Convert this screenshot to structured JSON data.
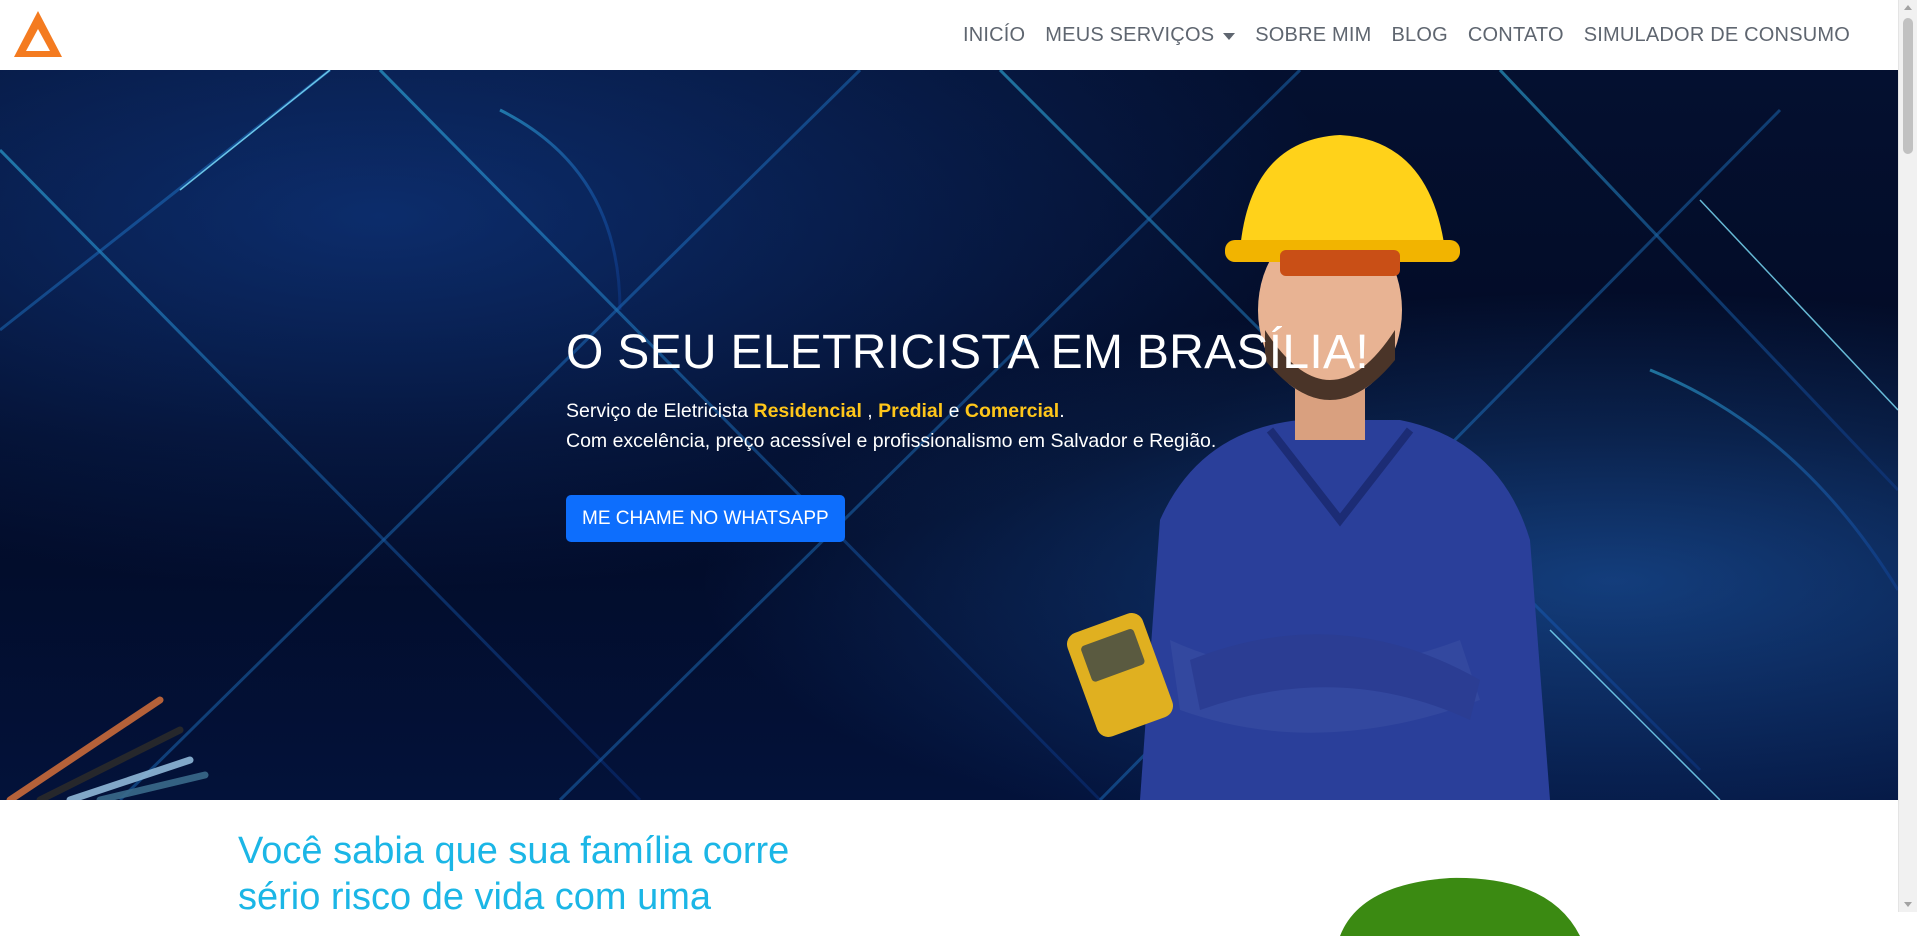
{
  "nav": {
    "logo_icon": "triangle-logo-icon",
    "items": [
      {
        "label": "INICÍO"
      },
      {
        "label": "MEUS SERVIÇOS",
        "dropdown": true
      },
      {
        "label": "SOBRE MIM"
      },
      {
        "label": "BLOG"
      },
      {
        "label": "CONTATO"
      },
      {
        "label": "SIMULADOR DE CONSUMO"
      }
    ]
  },
  "hero": {
    "title": "O SEU ELETRICISTA EM BRASÍLIA!",
    "line1_prefix": "Serviço de Eletricista ",
    "residencial": "Residencial",
    "sep1": " , ",
    "predial": "Predial",
    "sep2": " e ",
    "comercial": "Comercial",
    "line1_suffix": ".",
    "line2": "Com excelência, preço acessível e profissionalismo em Salvador e Região.",
    "cta_label": "ME CHAME NO WHATSAPP"
  },
  "info": {
    "heading": "Você sabia que sua família corre sério risco de vida com uma"
  },
  "colors": {
    "accent_orange": "#f47b20",
    "highlight_yellow": "#ffc61a",
    "cta_blue": "#0d6efd",
    "heading_cyan": "#1bb6e6",
    "hero_dark": "#020a24"
  }
}
